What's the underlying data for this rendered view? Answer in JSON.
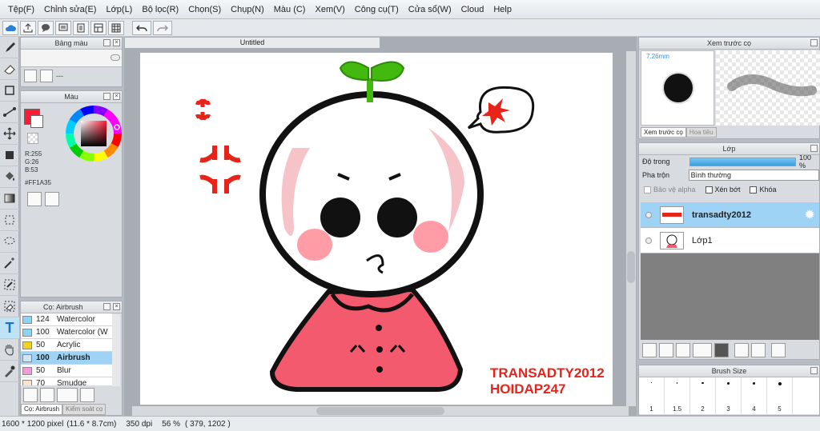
{
  "menu": [
    "Tệp(F)",
    "Chỉnh sửa(E)",
    "Lớp(L)",
    "Bộ lọc(R)",
    "Chọn(S)",
    "Chụp(N)",
    "Màu (C)",
    "Xem(V)",
    "Công cụ(T)",
    "Cửa sổ(W)",
    "Cloud",
    "Help"
  ],
  "toolbar_icons": [
    "cloud-icon",
    "export-icon",
    "chat-icon",
    "comment-icon",
    "page-icon",
    "layout-icon",
    "grid-icon",
    "undo-icon",
    "redo-icon"
  ],
  "palette_panel": {
    "title": "Bảng màu",
    "dash": "---"
  },
  "color_panel": {
    "title": "Màu",
    "r": "R:255",
    "g": "G:26",
    "b": "B:53",
    "hex": "#FF1A35",
    "main_color": "#ff1a35"
  },
  "brush_panel": {
    "title": "Cọ: Airbrush",
    "items": [
      {
        "num": "124",
        "name": "Watercolor",
        "color": "#8fd3f2"
      },
      {
        "num": "100",
        "name": "Watercolor (W",
        "color": "#8fd3f2"
      },
      {
        "num": "50",
        "name": "Acrylic",
        "color": "#f2d21c"
      },
      {
        "num": "100",
        "name": "Airbrush",
        "color": "#cfe6f8"
      },
      {
        "num": "50",
        "name": "Blur",
        "color": "#f29ad8"
      },
      {
        "num": "70",
        "name": "Smudge",
        "color": "#f8e6c8"
      }
    ],
    "tab1": "Cọ: Airbrush",
    "tab2": "Kiểm soát cọ"
  },
  "document": {
    "tab": "Untitled"
  },
  "artwork": {
    "watermark_line1": "TRANSADTY2012",
    "watermark_line2": "HOIDAP247"
  },
  "preview_panel": {
    "title": "Xem trước cọ",
    "size": "7.26mm",
    "tab1": "Xem trước cọ",
    "tab2": "Hoa tiêu"
  },
  "layer_panel": {
    "title": "Lớp",
    "opacity_label": "Độ trong",
    "opacity_value": "100 %",
    "opacity": 1.0,
    "blend_label": "Pha trộn",
    "blend_value": "Bình thường",
    "protect_alpha": "Bảo vệ alpha",
    "clip": "Xén bớt",
    "lock": "Khóa",
    "layers": [
      {
        "name": "transadty2012"
      },
      {
        "name": "Lớp1"
      }
    ]
  },
  "brushsize_panel": {
    "title": "Brush Size",
    "sizes": [
      "1",
      "1.5",
      "2",
      "3",
      "4",
      "5"
    ]
  },
  "status": {
    "dims": "1600 * 1200 pixel",
    "physical": "(11.6 * 8.7cm)",
    "dpi": "350 dpi",
    "zoom": "56 %",
    "coords": "( 379, 1202 )"
  }
}
